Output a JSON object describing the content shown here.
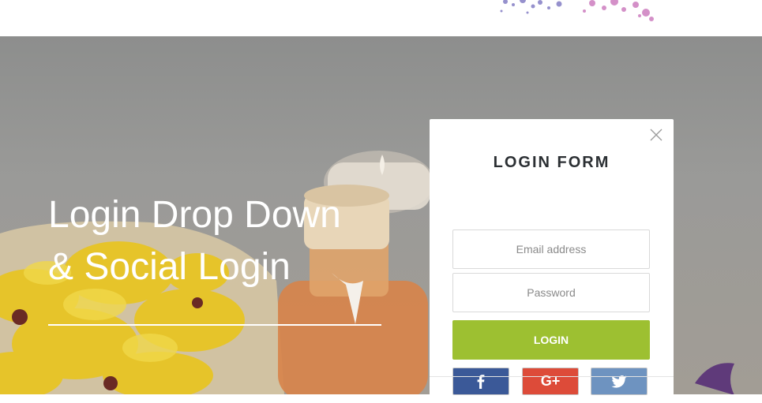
{
  "hero": {
    "headline_line1": "Login Drop Down",
    "headline_line2": "& Social Login"
  },
  "login_form": {
    "title": "LOGIN FORM",
    "email_placeholder": "Email address",
    "password_placeholder": "Password",
    "login_button": "LOGIN",
    "social": [
      {
        "name": "facebook",
        "icon": "facebook-icon",
        "color": "#3b5998"
      },
      {
        "name": "google-plus",
        "icon": "google-plus-icon",
        "label": "G+",
        "color": "#dd4b39"
      },
      {
        "name": "twitter",
        "icon": "twitter-icon",
        "color": "#6e93c0"
      }
    ]
  },
  "colors": {
    "accent_green": "#9dc031",
    "title_text": "#2b2f33"
  }
}
